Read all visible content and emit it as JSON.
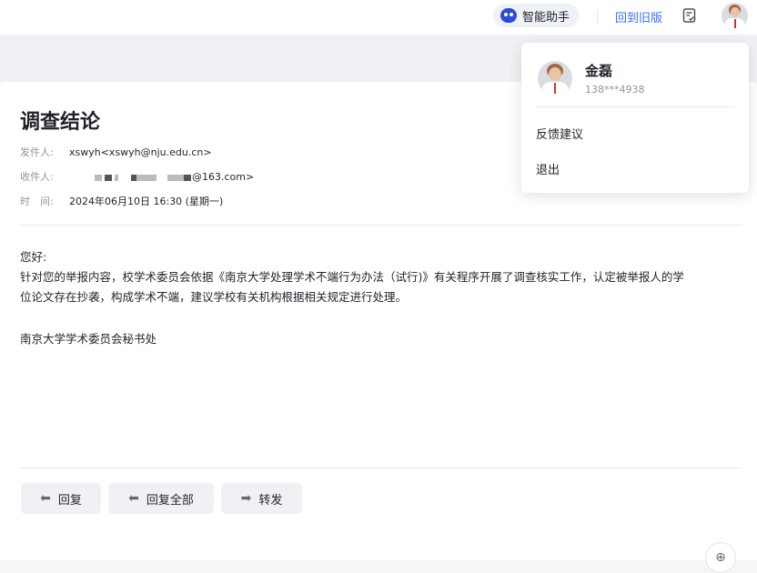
{
  "topbar": {
    "ai_assistant_label": "智能助手",
    "old_version_link": "回到旧版",
    "accent_color": "#3370ff"
  },
  "mail": {
    "subject": "调查结论",
    "sender_label": "发件人:",
    "sender_value": "xswyh<xswyh@nju.edu.cn>",
    "recipient_label": "收件人:",
    "recipient_visible_suffix": "@163.com>",
    "time_label": "时　间:",
    "time_value": "2024年06月10日 16:30 (星期一)",
    "body": {
      "greeting": "您好:",
      "paragraph_line1": "针对您的举报内容，校学术委员会依据《南京大学处理学术不端行为办法（试行)》有关程序开展了调查核实工作，认定被举报人的学",
      "paragraph_line2": "位论文存在抄袭，构成学术不端，建议学校有关机构根据相关规定进行处理。",
      "signature": "南京大学学术委员会秘书处"
    },
    "actions": {
      "reply": "回复",
      "reply_all": "回复全部",
      "forward": "转发"
    }
  },
  "profile_menu": {
    "name": "金磊",
    "phone": "138***4938",
    "feedback": "反馈建议",
    "logout": "退出"
  },
  "icons": {
    "ai": "robot-icon",
    "note": "note-check-icon",
    "reply": "reply-arrow-icon",
    "reply_all": "reply-all-arrow-icon",
    "forward": "forward-arrow-icon",
    "zoom": "zoom-plus-icon"
  }
}
